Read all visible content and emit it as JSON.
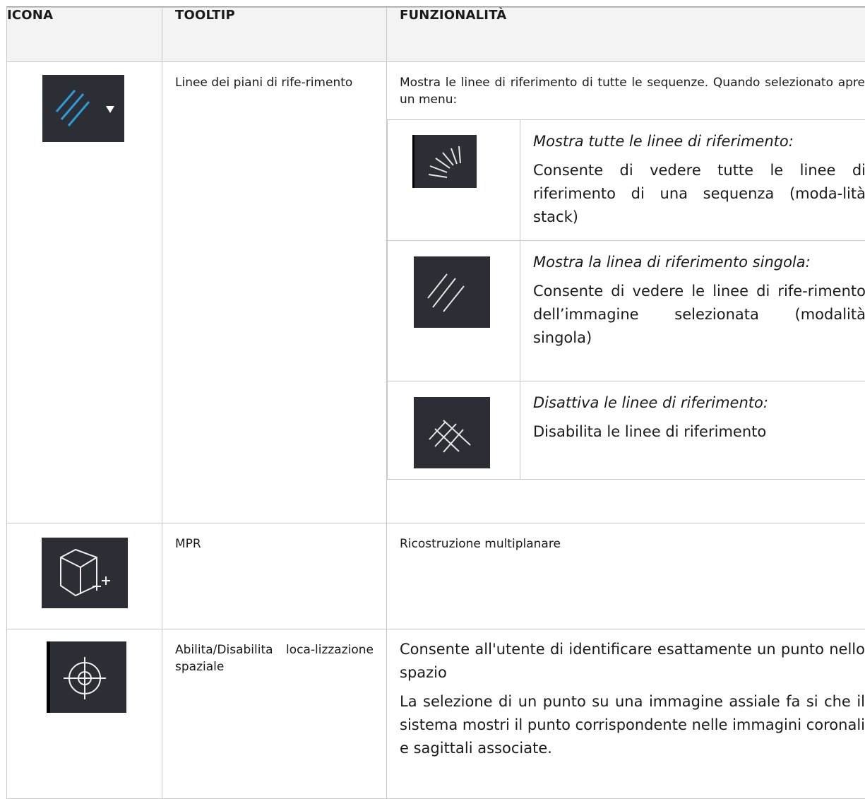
{
  "header": {
    "icon_col": "ICONA",
    "tooltip_col": "TOOLTIP",
    "function_col": "FUNZIONALITÀ"
  },
  "rows": [
    {
      "icon": "reference-lines-icon",
      "tooltip": "Linee dei piani di rife-rimento",
      "function": "Mostra le linee di riferimento di tutte le sequenze. Quando selezionato apre un menu:",
      "submenu": [
        {
          "icon": "all-reference-lines-icon",
          "title": "Mostra tutte le linee di riferimento:",
          "description": "Consente di vedere tutte le linee di riferimento di una sequenza (moda-lità stack)"
        },
        {
          "icon": "single-reference-line-icon",
          "title": "Mostra la linea di riferimento singola:",
          "description": "Consente di vedere le linee di rife-rimento dell’immagine selezionata (modalità singola)"
        },
        {
          "icon": "disable-reference-lines-icon",
          "title": "Disattiva le linee di riferimento:",
          "description": "Disabilita le linee di riferimento"
        }
      ]
    },
    {
      "icon": "mpr-cube-icon",
      "tooltip": "MPR",
      "function": "Ricostruzione multiplanare"
    },
    {
      "icon": "spatial-localization-crosshair-icon",
      "tooltip": "Abilita/Disabilita loca-lizzazione spaziale",
      "function_p1": "Consente all'utente di identificare esattamente un punto nello spazio",
      "function_p2": "La selezione di un punto su una immagine assiale fa si che il sistema mostri il punto corrispondente nelle immagini coronali e sagittali associate."
    }
  ],
  "colors": {
    "icon_bg": "#2b2f35",
    "accent_blue": "#2e9bd6",
    "header_bg": "#f3f3f3"
  }
}
